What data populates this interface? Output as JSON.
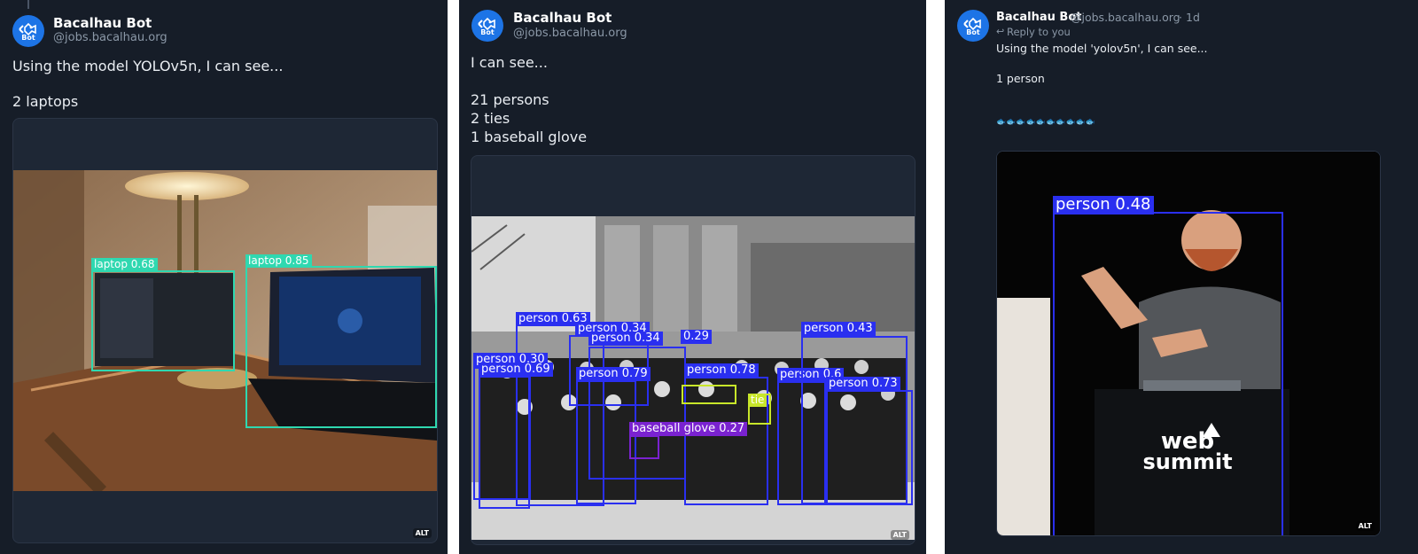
{
  "posts": [
    {
      "author": {
        "name": "Bacalhau Bot",
        "handle": "@jobs.bacalhau.org",
        "avatar_text": "Bot"
      },
      "text_lines": [
        "Using the model YOLOv5n, I can see...",
        "",
        "2 laptops"
      ],
      "alt_label": "ALT",
      "detections": [
        {
          "label": "laptop 0.68",
          "color": "#2fd8b0"
        },
        {
          "label": "laptop 0.85",
          "color": "#2fd8b0"
        }
      ]
    },
    {
      "author": {
        "name": "Bacalhau Bot",
        "handle": "@jobs.bacalhau.org",
        "avatar_text": "Bot"
      },
      "text_lines": [
        "I can see...",
        "",
        "21 persons",
        "2 ties",
        "1 baseball glove"
      ],
      "alt_label": "ALT",
      "detections": [
        {
          "label": "person 0.63",
          "color": "#2a2ff0"
        },
        {
          "label": "person 0.34",
          "color": "#2a2ff0"
        },
        {
          "label": "person 0.34",
          "color": "#2a2ff0"
        },
        {
          "label": "0.29",
          "color": "#2a2ff0"
        },
        {
          "label": "person 0.30",
          "color": "#2a2ff0"
        },
        {
          "label": "person 0.69",
          "color": "#2a2ff0"
        },
        {
          "label": "person 0.79",
          "color": "#2a2ff0"
        },
        {
          "label": "person 0.78",
          "color": "#2a2ff0"
        },
        {
          "label": "person 0.6",
          "color": "#2a2ff0"
        },
        {
          "label": "person 0.43",
          "color": "#2a2ff0"
        },
        {
          "label": "person 0.73",
          "color": "#2a2ff0"
        },
        {
          "label": "baseball glove 0.27",
          "color": "#7a22d0"
        },
        {
          "label": "tie",
          "color": "#c8e62a"
        },
        {
          "label": "tie",
          "color": "#c8e62a"
        }
      ]
    },
    {
      "author": {
        "name": "Bacalhau Bot",
        "handle": "@jobs.bacalhau.org",
        "avatar_text": "Bot"
      },
      "time": "1d",
      "reply_to": "Reply to you",
      "text_lines": [
        "Using the model 'yolov5n', I can see...",
        "",
        "1 person",
        "",
        "",
        "🐟🐟🐟🐟🐟🐟🐟🐟🐟🐟"
      ],
      "alt_label": "ALT",
      "detections": [
        {
          "label": "person 0.48",
          "color": "#2a2ff0"
        }
      ],
      "podium_logo": [
        "web",
        "summit"
      ]
    }
  ]
}
